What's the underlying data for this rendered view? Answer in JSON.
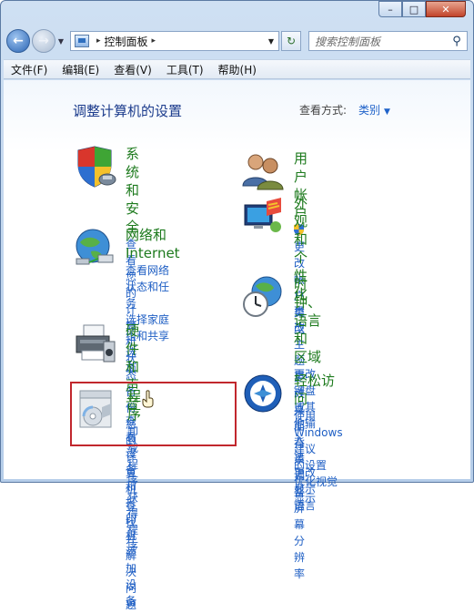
{
  "window": {
    "minimize_glyph": "–",
    "maximize_glyph": "□",
    "close_glyph": "✕"
  },
  "address_bar": {
    "path": "控制面板",
    "separator": "▸",
    "search_placeholder": "搜索控制面板"
  },
  "menu": [
    "文件(F)",
    "编辑(E)",
    "查看(V)",
    "工具(T)",
    "帮助(H)"
  ],
  "header": {
    "title": "调整计算机的设置",
    "view_by_label": "查看方式:",
    "view_by_value": "类别"
  },
  "left_categories": [
    {
      "name": "system-security",
      "heading": "系统和安全",
      "links": [
        "查看您的计算机状态",
        "备份您的计算机",
        "查找并解决问题"
      ]
    },
    {
      "name": "network-internet",
      "heading_lines": [
        "网络和",
        "Internet"
      ],
      "links": [
        "查看网络状态和任务",
        "选择家庭组和共享选",
        "项"
      ]
    },
    {
      "name": "hardware-sound",
      "heading": "硬件和声音",
      "links": [
        "查看设备和打印机",
        "添加设备"
      ]
    },
    {
      "name": "programs",
      "heading": "程序",
      "links": [
        "卸载程序",
        "获得程序"
      ]
    }
  ],
  "right_categories": [
    {
      "name": "user-accounts",
      "heading": "用户帐户",
      "links": [
        "更改帐户类型"
      ]
    },
    {
      "name": "appearance",
      "heading": "外观和个性化",
      "links": [
        "更改主题",
        "更改桌面背景",
        "调整屏幕分辨率"
      ]
    },
    {
      "name": "clock-region",
      "heading_lines": [
        "时钟、语言和",
        "区域"
      ],
      "links": [
        "更改键盘或其他输入",
        "法",
        "更改显示语言"
      ]
    },
    {
      "name": "ease-of-access",
      "heading": "轻松访问",
      "links": [
        "使用 Windows 建议",
        "的设置",
        "优化视觉显示"
      ]
    }
  ],
  "colors": {
    "heading_green": "#1d7a1d",
    "link_blue": "#1f5fc4",
    "title_blue": "#1b3b8c",
    "highlight_red": "#c1272d"
  }
}
